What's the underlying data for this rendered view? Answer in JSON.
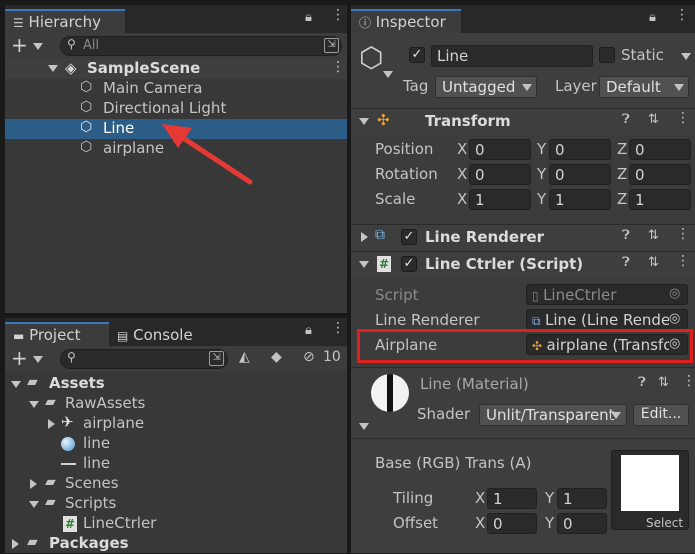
{
  "hierarchy": {
    "tab_label": "Hierarchy",
    "search_placeholder": "All",
    "scene_name": "SampleScene",
    "items": [
      "Main Camera",
      "Directional Light",
      "Line",
      "airplane"
    ],
    "selected_item": "Line"
  },
  "project": {
    "tab_label": "Project",
    "console_tab_label": "Console",
    "hidden_count": "10",
    "tree": {
      "assets": "Assets",
      "raw_assets": "RawAssets",
      "airplane": "airplane",
      "line_material": "line",
      "line_mesh": "line",
      "scenes": "Scenes",
      "scripts": "Scripts",
      "line_ctrler": "LineCtrler",
      "packages": "Packages"
    }
  },
  "inspector": {
    "tab_label": "Inspector",
    "object_name": "Line",
    "static_label": "Static",
    "tag_label": "Tag",
    "tag_value": "Untagged",
    "layer_label": "Layer",
    "layer_value": "Default",
    "transform": {
      "title": "Transform",
      "position_label": "Position",
      "rotation_label": "Rotation",
      "scale_label": "Scale",
      "x": "X",
      "y": "Y",
      "z": "Z",
      "position": [
        "0",
        "0",
        "0"
      ],
      "rotation": [
        "0",
        "0",
        "0"
      ],
      "scale": [
        "1",
        "1",
        "1"
      ]
    },
    "line_renderer": {
      "title": "Line Renderer"
    },
    "line_ctrler": {
      "title": "Line Ctrler (Script)",
      "script_label": "Script",
      "script_value": "LineCtrler",
      "line_renderer_label": "Line Renderer",
      "line_renderer_value": "Line (Line Rende",
      "airplane_label": "Airplane",
      "airplane_value": "airplane (Transfo"
    },
    "material": {
      "title": "Line (Material)",
      "shader_label": "Shader",
      "shader_value": "Unlit/Transparent",
      "edit_label": "Edit...",
      "base_label": "Base (RGB) Trans (A)",
      "tiling_label": "Tiling",
      "offset_label": "Offset",
      "tiling": [
        "1",
        "1"
      ],
      "offset": [
        "0",
        "0"
      ],
      "x": "X",
      "y": "Y",
      "select_label": "Select"
    }
  },
  "colors": {
    "selection": "#2c5d87",
    "highlight_box": "#e0201f",
    "arrow": "#e53935",
    "tab_accent": "#3a79bb"
  }
}
